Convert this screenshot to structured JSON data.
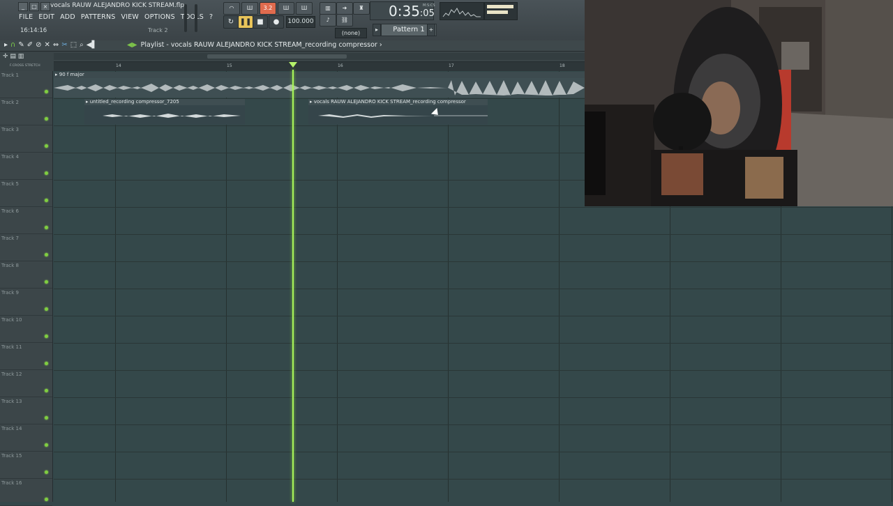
{
  "window": {
    "title": "vocals RAUW ALEJANDRO KICK STREAM.flp",
    "controls": [
      "_",
      "□",
      "×"
    ]
  },
  "menu": [
    "FILE",
    "EDIT",
    "ADD",
    "PATTERNS",
    "VIEW",
    "OPTIONS",
    "TOOLS",
    "?"
  ],
  "hint": {
    "time": "16:14:16",
    "track": "Track 2"
  },
  "toolbar": {
    "tempo": "100.000",
    "clock_main": "0:35",
    "clock_sub": ":05",
    "clock_unit": "M:S:CS",
    "toggle_value": "3.2",
    "snap": "(none)",
    "pattern": "Pattern 1"
  },
  "playlist": {
    "title": "Playlist - vocals RAUW ALEJANDRO KICK STREAM_recording compressor ›",
    "ruler_ticks": [
      "14",
      "15",
      "16",
      "17",
      "18"
    ],
    "mini_labels": "F.CROSS   STRETCH",
    "tracks": [
      "Track 1",
      "Track 2",
      "Track 3",
      "Track 4",
      "Track 5",
      "Track 6",
      "Track 7",
      "Track 8",
      "Track 9",
      "Track 10",
      "Track 11",
      "Track 12",
      "Track 13",
      "Track 14",
      "Track 15",
      "Track 16"
    ],
    "clips": [
      {
        "label": "▸ 90 f major"
      },
      {
        "label": "▸ untitled_recording compressor_7205"
      },
      {
        "label": "▸ vocals RAUW ALEJANDRO KICK STREAM_recording compressor"
      }
    ]
  },
  "icons": {
    "playlist": "play-triangle-icon",
    "tools": [
      "magnet-icon",
      "pencil-icon",
      "brush-icon",
      "delete-icon",
      "mute-icon",
      "slip-icon",
      "slice-icon",
      "select-icon",
      "zoom-icon",
      "playback-icon"
    ]
  },
  "colors": {
    "accent": "#a9f55a",
    "background": "#34484a",
    "led": "#7fcf3f",
    "record_active": "#e06b4e"
  }
}
